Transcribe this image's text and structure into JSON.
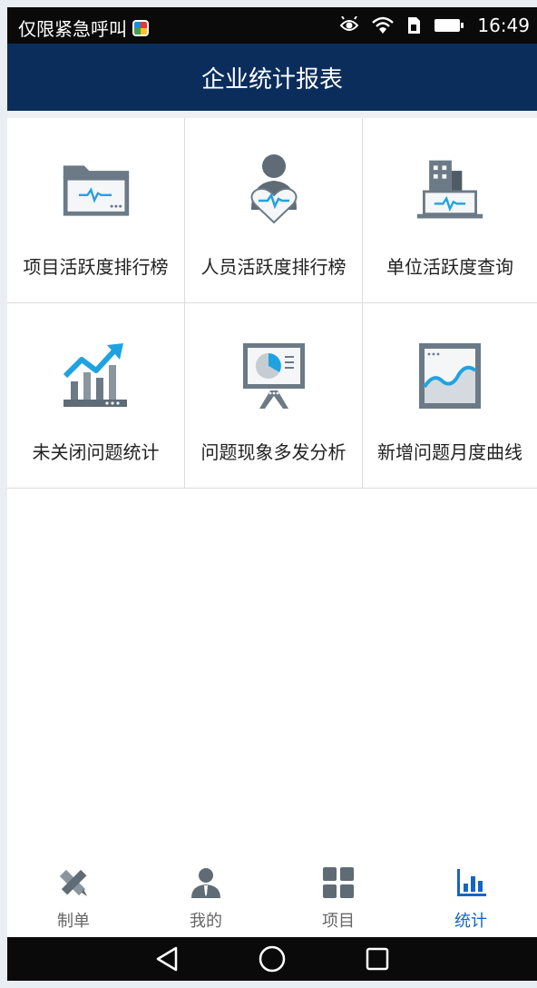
{
  "status_bar": {
    "carrier_text": "仅限紧急呼叫",
    "time": "16:49",
    "icons": [
      "app-icon",
      "eye-icon",
      "wifi-icon",
      "sim-icon",
      "battery-icon"
    ]
  },
  "header": {
    "title": "企业统计报表"
  },
  "grid": {
    "items": [
      {
        "label": "项目活跃度排行榜",
        "icon": "folder-activity-icon"
      },
      {
        "label": "人员活跃度排行榜",
        "icon": "person-heartbeat-icon"
      },
      {
        "label": "单位活跃度查询",
        "icon": "building-activity-icon"
      },
      {
        "label": "未关闭问题统计",
        "icon": "bar-trend-icon"
      },
      {
        "label": "问题现象多发分析",
        "icon": "presentation-pie-icon"
      },
      {
        "label": "新增问题月度曲线",
        "icon": "line-chart-icon"
      }
    ]
  },
  "bottom_nav": {
    "items": [
      {
        "label": "制单",
        "icon": "pen-ruler-icon",
        "active": false
      },
      {
        "label": "我的",
        "icon": "person-icon",
        "active": false
      },
      {
        "label": "项目",
        "icon": "grid-icon",
        "active": false
      },
      {
        "label": "统计",
        "icon": "bar-chart-icon",
        "active": true
      }
    ]
  },
  "colors": {
    "header_bg": "#0b2d5b",
    "active_nav": "#1565c0",
    "icon_gray": "#6b7a86",
    "icon_accent": "#1fa3e0"
  }
}
